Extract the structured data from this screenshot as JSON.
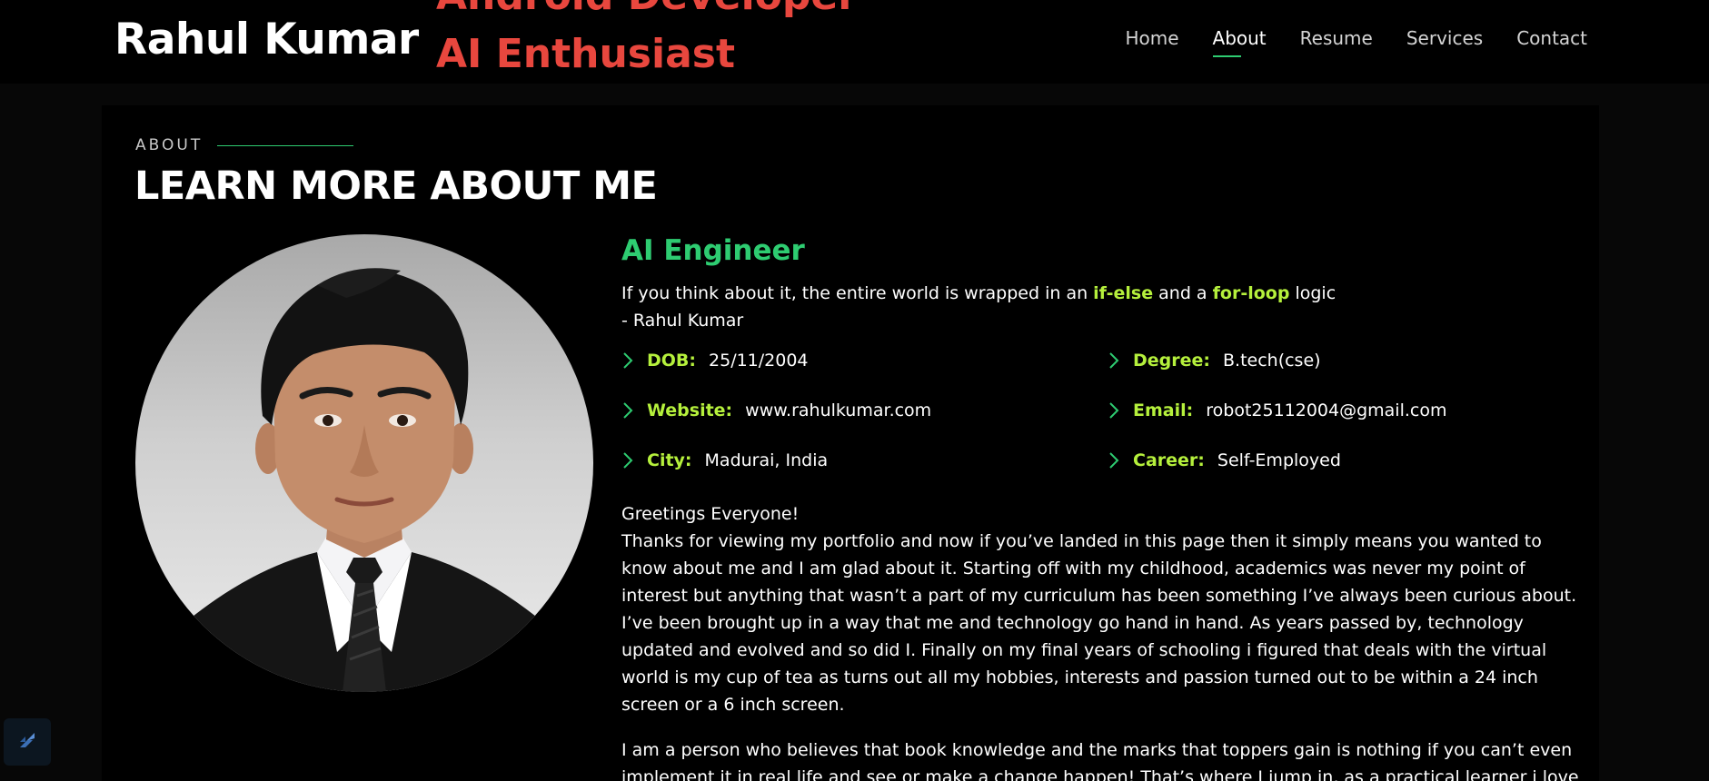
{
  "header": {
    "logo": "Rahul Kumar",
    "typed_previous": "Android Developer",
    "typed_current": "AI Enthusiast",
    "nav": [
      {
        "label": "Home"
      },
      {
        "label": "About"
      },
      {
        "label": "Resume"
      },
      {
        "label": "Services"
      },
      {
        "label": "Contact"
      }
    ],
    "active_nav": "About"
  },
  "section": {
    "eyebrow": "ABOUT",
    "title": "LEARN MORE ABOUT ME"
  },
  "profile": {
    "role": "AI Engineer",
    "quote_pre": "If you think about it, the entire world is wrapped in an ",
    "quote_hl1": "if-else",
    "quote_mid": " and a ",
    "quote_hl2": "for-loop",
    "quote_post": " logic",
    "quote_author": "- Rahul Kumar",
    "info": {
      "dob": {
        "label": "DOB:",
        "value": "25/11/2004"
      },
      "degree": {
        "label": "Degree:",
        "value": "B.tech(cse)"
      },
      "website": {
        "label": "Website:",
        "value": "www.rahulkumar.com"
      },
      "email": {
        "label": "Email:",
        "value": "robot25112004@gmail.com"
      },
      "city": {
        "label": "City:",
        "value": "Madurai, India"
      },
      "career": {
        "label": "Career:",
        "value": "Self-Employed"
      }
    },
    "bio_greeting": "Greetings Everyone!",
    "bio_p1": "Thanks for viewing my portfolio and now if you’ve landed in this page then it simply means you wanted to know about me and I am glad about it. Starting off with my childhood, academics was never my point of interest but anything that wasn’t a part of my curriculum has been something I’ve always been curious about. I’ve been brought up in a way that me and technology go hand in hand. As years passed by, technology updated and evolved and so did I. Finally on my final years of schooling i figured that deals with the virtual world is my cup of tea as turns out all my hobbies, interests and passion turned out to be within a 24 inch screen or a 6 inch screen.",
    "bio_p2": "I am a person who believes that book knowledge and the marks that toppers gain is nothing if you can’t even implement it in real life and see or make a change happen! That’s where I jump in, as a practical learner i love to"
  },
  "colors": {
    "accent_green": "#2ecc71",
    "highlight_lime": "#b5f03c",
    "typed_red": "#e8473e",
    "background": "#000000"
  },
  "icons": {
    "bullet": "chevron-right-icon",
    "badge": "slash-logo-icon"
  }
}
